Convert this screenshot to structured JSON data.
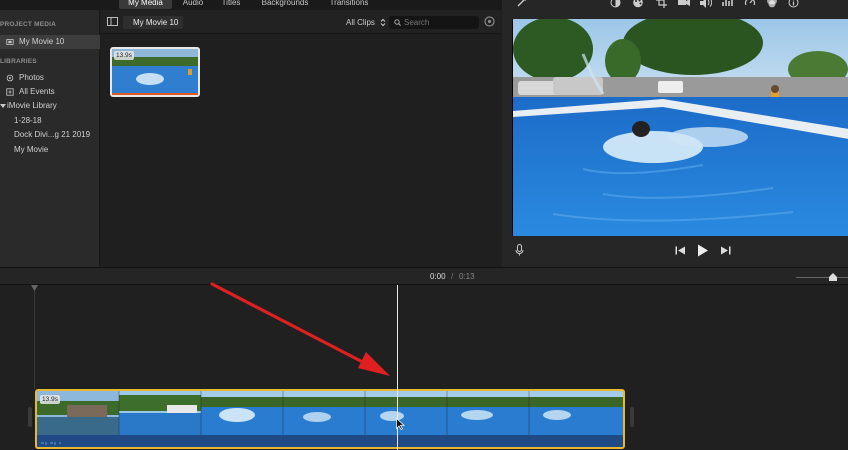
{
  "tabs": [
    {
      "label": "My Media",
      "active": true
    },
    {
      "label": "Audio"
    },
    {
      "label": "Titles"
    },
    {
      "label": "Backgrounds"
    },
    {
      "label": "Transitions"
    }
  ],
  "sidebar": {
    "project_media_header": "PROJECT MEDIA",
    "project_item": "My Movie 10",
    "libraries_header": "LIBRARIES",
    "items": [
      {
        "label": "Photos",
        "icon": "photos-icon"
      },
      {
        "label": "All Events",
        "icon": "all-events-icon"
      },
      {
        "label": "iMovie Library",
        "icon": "disclosure-triangle-icon"
      },
      {
        "label": "1-28-18"
      },
      {
        "label": "Dock Divi...g 21 2019"
      },
      {
        "label": "My Movie"
      }
    ]
  },
  "media": {
    "project_title": "My Movie 10",
    "filter": "All Clips",
    "search_placeholder": "Search",
    "clip_duration": "13.9s"
  },
  "viewer": {
    "toolbar_icons": [
      "magic-wand-icon",
      "color-balance-icon",
      "color-correction-icon",
      "crop-icon",
      "stabilization-icon",
      "volume-icon",
      "noise-reduction-icon",
      "speed-icon",
      "clip-filter-icon",
      "info-icon"
    ]
  },
  "timeline": {
    "current_time": "0:00",
    "separator": "/",
    "total_time": "0:13",
    "clip_duration": "13.9s"
  },
  "colors": {
    "accent_clip_border": "#e8b830",
    "arrow": "#e02020",
    "selection": "#3d3d3d"
  }
}
